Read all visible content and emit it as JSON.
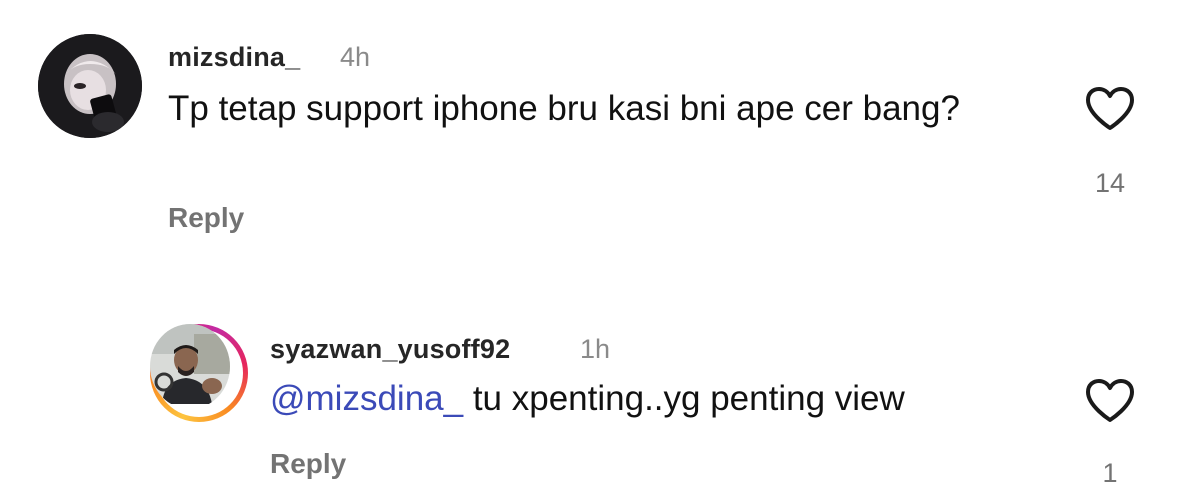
{
  "comments": [
    {
      "username": "mizsdina_",
      "time": "4h",
      "text": "Tp tetap support iphone bru kasi bni ape cer bang?",
      "reply_label": "Reply",
      "like_count": "14",
      "like_icon": "heart-outline-icon"
    },
    {
      "username": "syazwan_yusoff92",
      "time": "1h",
      "mention": "@mizsdina_",
      "text": " tu xpenting..yg penting view",
      "reply_label": "Reply",
      "like_count": "1",
      "like_icon": "heart-outline-icon",
      "has_story_ring": true
    }
  ],
  "colors": {
    "username": "#262626",
    "secondary": "#737373",
    "mention": "#3b4ab8",
    "story_ring": [
      "#fdc43f",
      "#f98a22",
      "#e6265c",
      "#c32aa3"
    ]
  }
}
